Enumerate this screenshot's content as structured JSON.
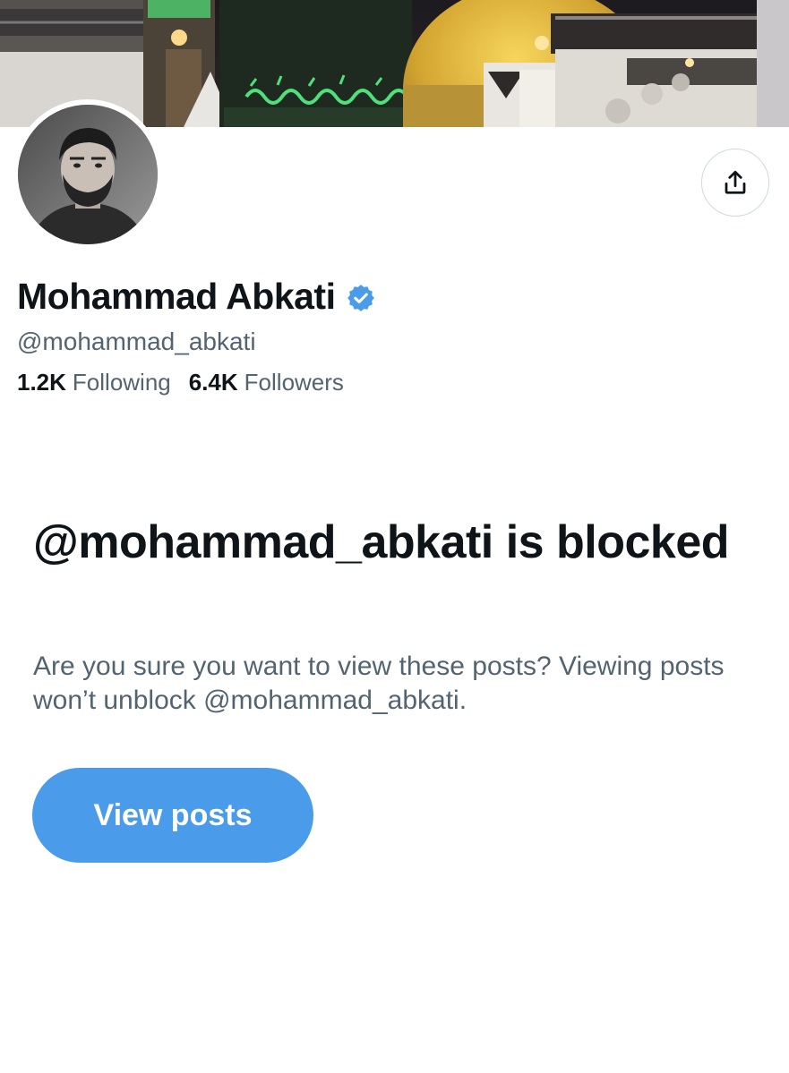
{
  "profile": {
    "display_name": "Mohammad Abkati",
    "handle": "@mohammad_abkati",
    "verified_icon": "verified-badge-icon",
    "following_count": "1.2K",
    "following_label": "Following",
    "followers_count": "6.4K",
    "followers_label": "Followers"
  },
  "header": {
    "share_icon": "share-icon"
  },
  "blocked_notice": {
    "title": "@mohammad_abkati is blocked",
    "description": "Are you sure you want to view these posts? Viewing posts won’t unblock @mohammad_abkati.",
    "button_label": "View posts"
  },
  "colors": {
    "accent": "#4a9be9",
    "text_primary": "#0f1419",
    "text_secondary": "#536471",
    "verified": "#4a9be9",
    "border": "#cfd9de"
  }
}
